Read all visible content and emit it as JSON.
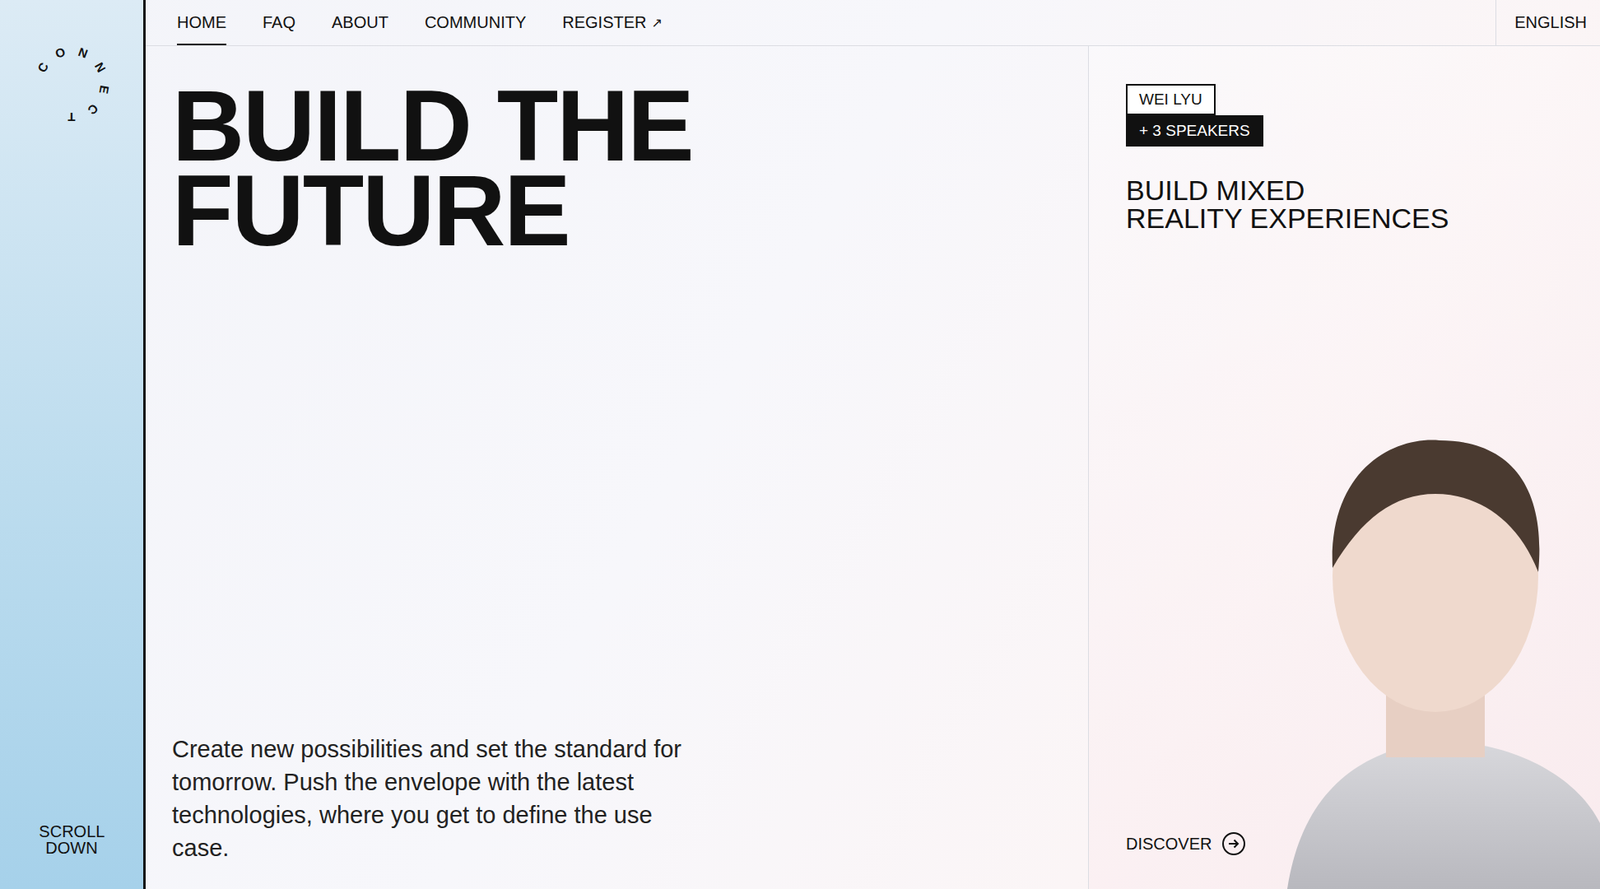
{
  "logo": {
    "text": "CONNECT"
  },
  "sidebar": {
    "scroll": "SCROLL DOWN"
  },
  "nav": {
    "items": [
      {
        "label": "HOME",
        "selected": true
      },
      {
        "label": "FAQ",
        "selected": false
      },
      {
        "label": "ABOUT",
        "selected": false
      },
      {
        "label": "COMMUNITY",
        "selected": false
      },
      {
        "label": "REGISTER",
        "selected": false,
        "icon": "↗"
      }
    ],
    "language": "ENGLISH"
  },
  "hero": {
    "title_lines": [
      "BUILD THE",
      "FUTURE"
    ],
    "text": "Create new possibilities and set the standard for tomorrow. Push the envelope with the latest technologies, where you get to define the use case."
  },
  "session": {
    "speaker": "WEI LYU",
    "more": "+ 3 SPEAKERS",
    "title_lines": [
      "BUILD MIXED",
      "REALITY EXPERIENCES"
    ],
    "link": "DISCOVER"
  }
}
